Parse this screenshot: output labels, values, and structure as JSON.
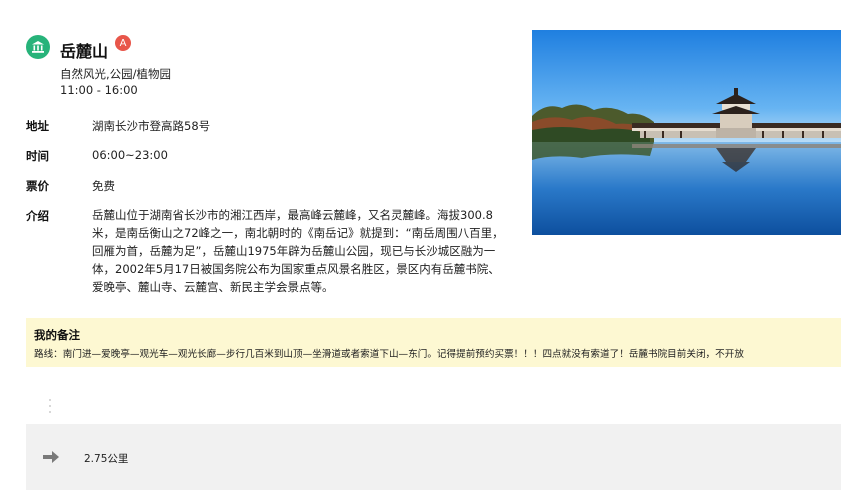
{
  "poi": {
    "title": "岳麓山",
    "marker": "A",
    "category": "自然风光,公园/植物园",
    "hours": "11:00 - 16:00",
    "icon": "landmark-icon",
    "icon_color": "#27b37a",
    "marker_color": "#e8564a"
  },
  "details": {
    "address_label": "地址",
    "address_value": "湖南长沙市登高路58号",
    "time_label": "时间",
    "time_value": "06:00~23:00",
    "ticket_label": "票价",
    "ticket_value": "免费",
    "intro_label": "介绍",
    "intro_text": "岳麓山位于湖南省长沙市的湘江西岸，最高峰云麓峰，又名灵麓峰。海拔300.8米，是南岳衡山之72峰之一，南北朝时的《南岳记》就提到：“南岳周围八百里，回雁为首，岳麓为足”，岳麓山1975年辟为岳麓山公园，现已与长沙城区融为一体，2002年5月17日被国务院公布为国家重点风景名胜区，景区内有岳麓书院、爱晚亭、麓山寺、云麓宫、新民主学会景点等。"
  },
  "note": {
    "title": "我的备注",
    "text": "路线：南门进—爱晚亭—观光车—观光长廊—步行几百米到山顶—坐滑道或者索道下山—东门。记得提前预约买票！！！四点就没有索道了！岳麓书院目前关闭，不开放",
    "background": "#fdf8d2"
  },
  "route": {
    "distance": "2.75公里",
    "icon": "arrow-right-icon"
  }
}
